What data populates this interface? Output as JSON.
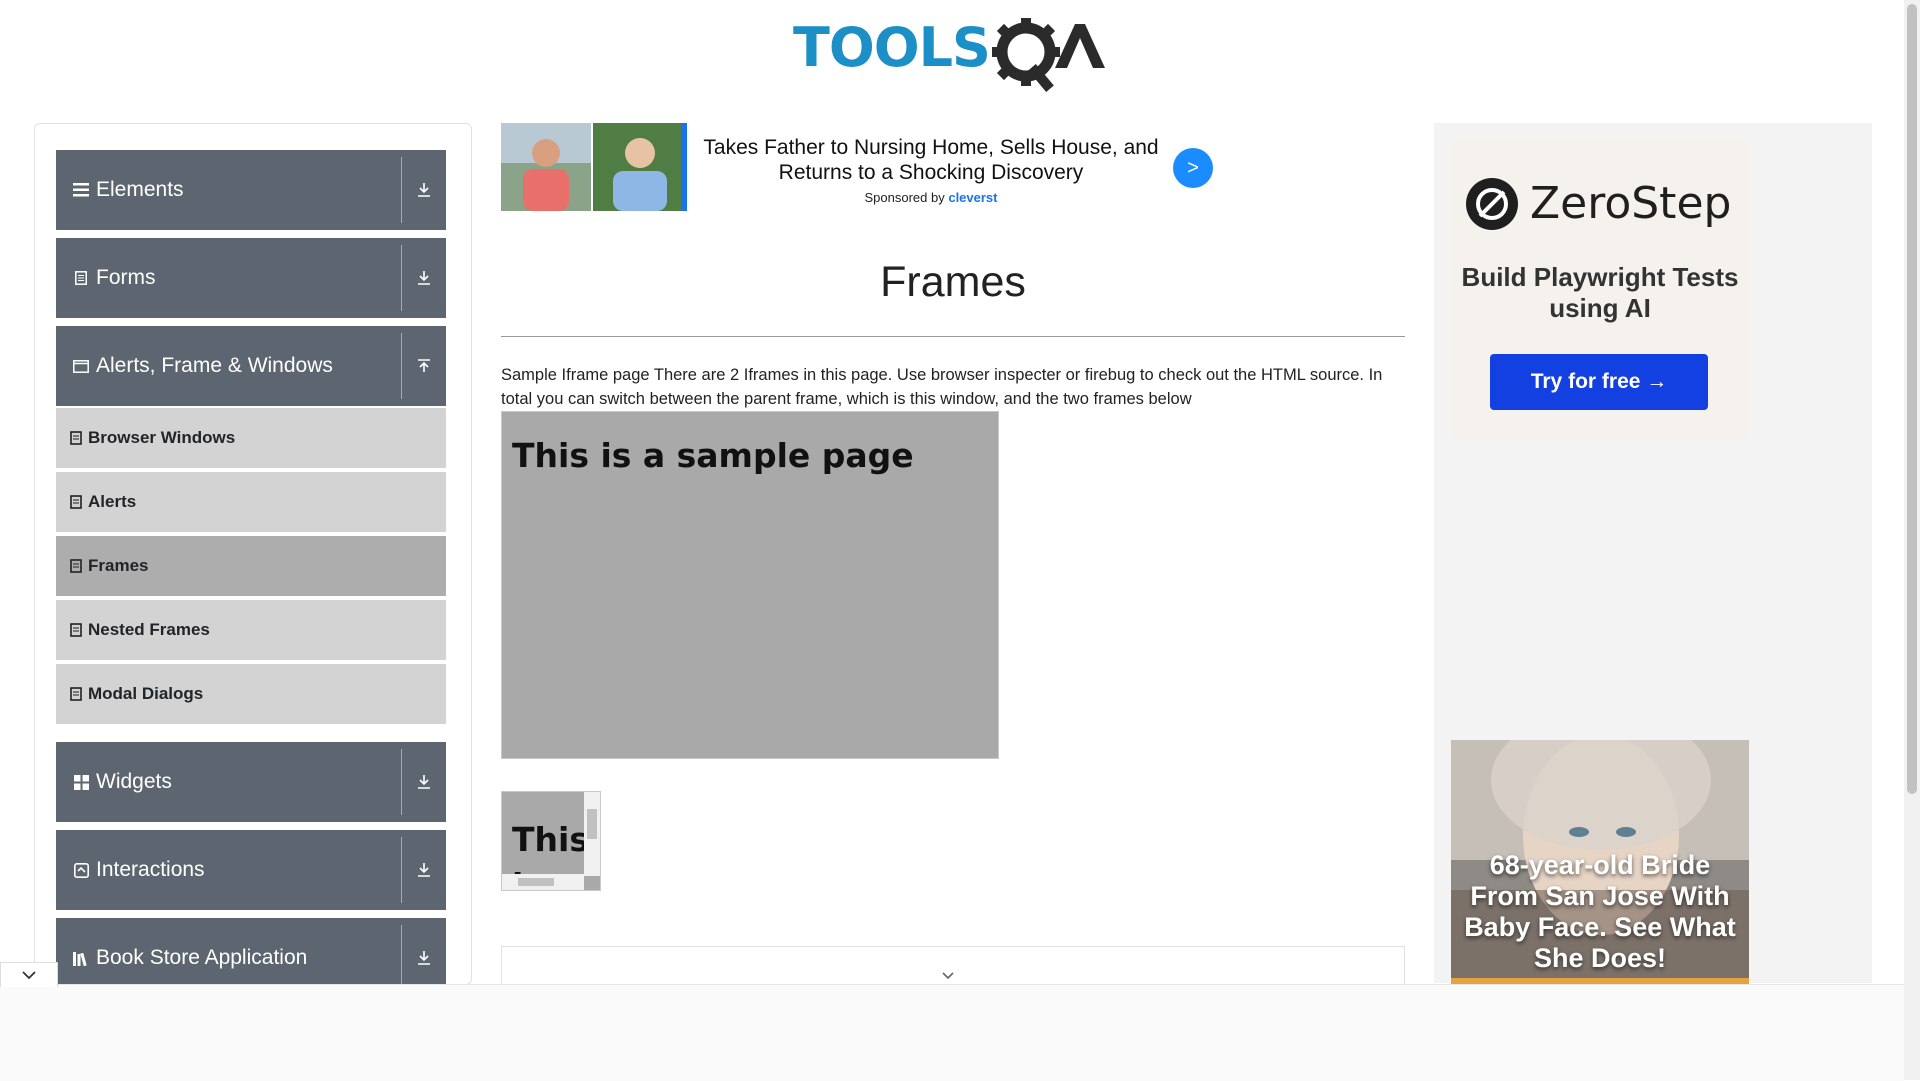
{
  "brand": {
    "logo_text": "TOOLSQA"
  },
  "sidebar": {
    "groups": [
      {
        "title": "Elements",
        "icon": "bars-icon",
        "toggle": "download-icon"
      },
      {
        "title": "Forms",
        "icon": "form-icon",
        "toggle": "download-icon"
      },
      {
        "title": "Alerts, Frame & Windows",
        "icon": "window-icon",
        "toggle": "upload-icon"
      },
      {
        "title": "Widgets",
        "icon": "widgets-icon",
        "toggle": "download-icon"
      },
      {
        "title": "Interactions",
        "icon": "interactions-icon",
        "toggle": "download-icon"
      },
      {
        "title": "Book Store Application",
        "icon": "books-icon",
        "toggle": "download-icon"
      }
    ],
    "items": [
      {
        "label": "Browser Windows"
      },
      {
        "label": "Alerts"
      },
      {
        "label": "Frames",
        "active": true
      },
      {
        "label": "Nested Frames"
      },
      {
        "label": "Modal Dialogs"
      }
    ]
  },
  "sponsor": {
    "headline": "Takes Father to Nursing Home, Sells House, and Returns to a Shocking Discovery",
    "sponsored_prefix": "Sponsored by",
    "sponsor_name": "cleverst",
    "go_label": ">"
  },
  "main": {
    "title": "Frames",
    "description": "Sample Iframe page There are 2 Iframes in this page. Use browser inspecter or firebug to check out the HTML source. In total you can switch between the parent frame, which is this window, and the two frames below",
    "frame1_heading": "This is a sample page",
    "frame2_heading": "This is a sample page"
  },
  "right_ad": {
    "brand": "ZeroStep",
    "tagline": "Build Playwright Tests using AI",
    "cta": "Try for free →",
    "bride_caption": "68-year-old Bride From San Jose With Baby Face. See What She Does!"
  },
  "colors": {
    "sidebar_header": "#5c6570",
    "menu_item": "#d3d3d3",
    "menu_item_active": "#adadad",
    "frame_bg": "#a9a9a9",
    "cta_blue": "#1340e0",
    "logo_blue": "#1b8fc6"
  }
}
